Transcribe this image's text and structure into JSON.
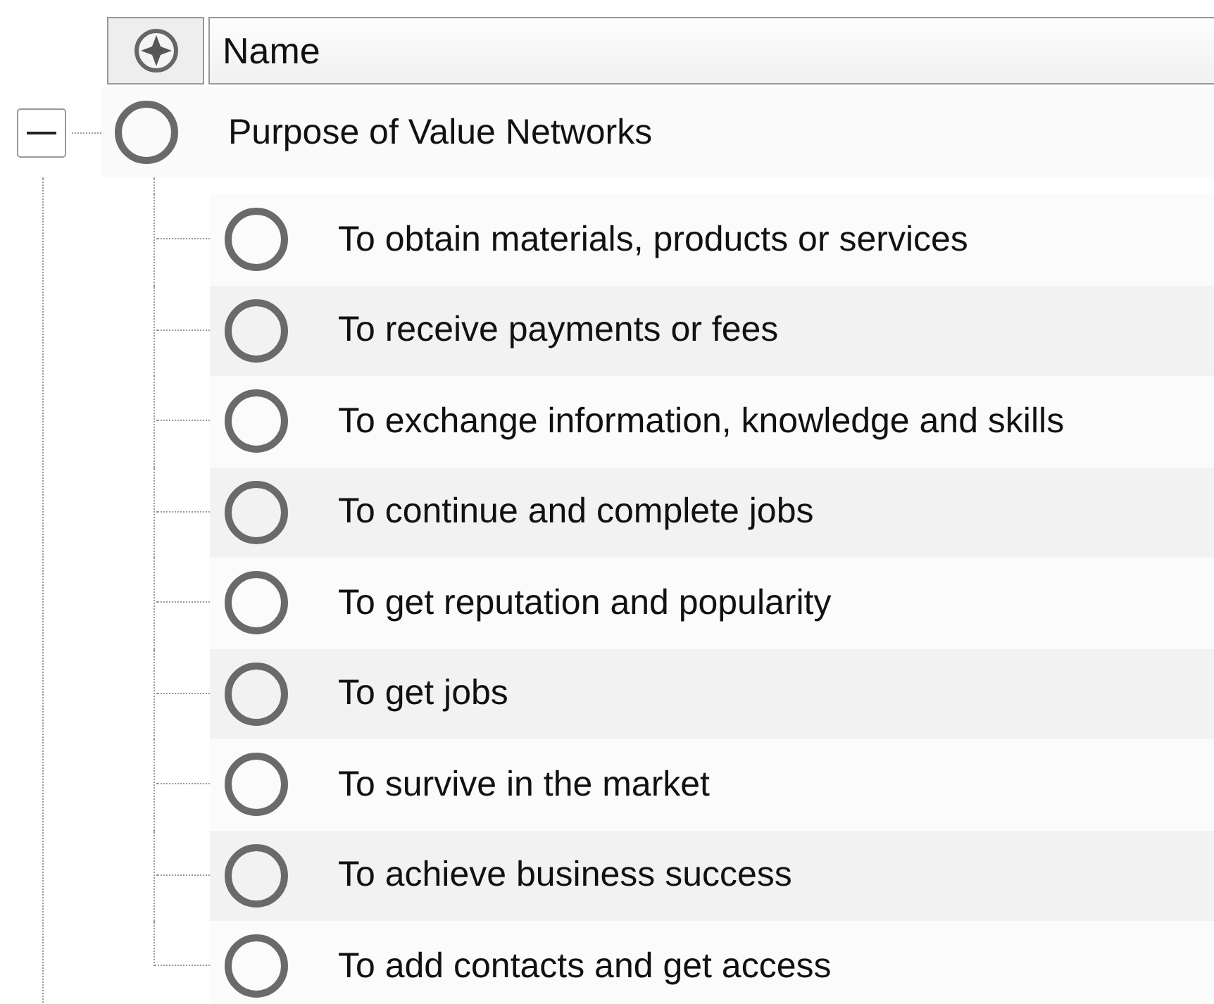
{
  "header": {
    "name_column": "Name"
  },
  "tree": {
    "label": "Purpose of Value Networks",
    "expanded": true,
    "children": [
      {
        "label": "To obtain materials, products or services"
      },
      {
        "label": "To receive payments or fees"
      },
      {
        "label": "To exchange information, knowledge and skills"
      },
      {
        "label": "To continue and complete jobs"
      },
      {
        "label": "To get reputation and popularity"
      },
      {
        "label": "To get jobs"
      },
      {
        "label": "To survive in the market"
      },
      {
        "label": "To achieve business success"
      },
      {
        "label": "To add contacts and get access"
      }
    ]
  }
}
